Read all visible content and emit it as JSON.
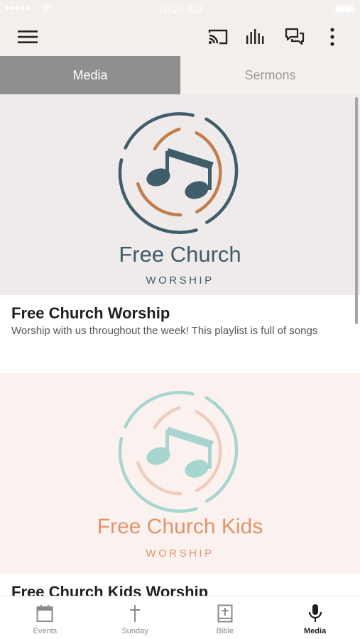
{
  "status_bar": {
    "time": "10:26 AM"
  },
  "tabs": [
    {
      "label": "Media",
      "active": true
    },
    {
      "label": "Sermons",
      "active": false
    }
  ],
  "cards": [
    {
      "logo_title": "Free Church",
      "logo_subtitle": "WORSHIP",
      "title": "Free Church Worship",
      "description": "Worship with us throughout the week! This playlist is full of songs",
      "colors": {
        "background": "#efebea",
        "ring_outer": "#3f5d6a",
        "ring_inner": "#c27e4e",
        "note": "#3f5d6a",
        "logo_text": "#3f5d6a"
      }
    },
    {
      "logo_title": "Free Church Kids",
      "logo_subtitle": "WORSHIP",
      "title": "Free Church Kids Worship",
      "colors": {
        "background": "#fbf2ef",
        "ring_outer": "#a7d5cf",
        "ring_inner": "#efcdbd",
        "note": "#a7d5cf",
        "logo_text": "#e0946b"
      }
    }
  ],
  "bottom_nav": [
    {
      "label": "Events",
      "icon": "calendar-icon",
      "active": false
    },
    {
      "label": "Sunday",
      "icon": "cross-icon",
      "active": false
    },
    {
      "label": "Bible",
      "icon": "bible-icon",
      "active": false
    },
    {
      "label": "Media",
      "icon": "microphone-icon",
      "active": true
    }
  ],
  "top_bar_icons": [
    "menu-icon",
    "cast-icon",
    "audio-bars-icon",
    "chat-icon",
    "more-vertical-icon"
  ]
}
